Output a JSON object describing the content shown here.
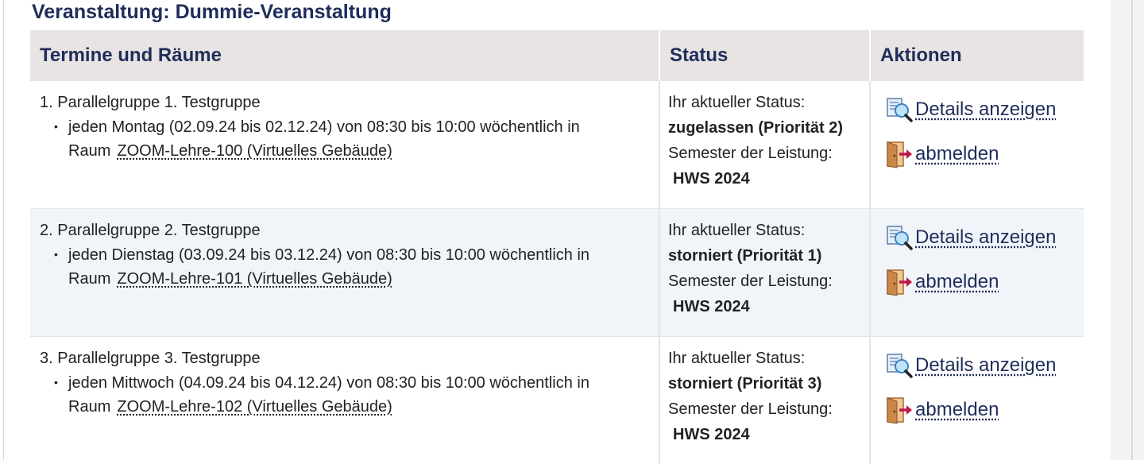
{
  "page": {
    "heading": "Veranstaltung: Dummie-Veranstaltung"
  },
  "table": {
    "headers": {
      "col1": "Termine und Räume",
      "col2": "Status",
      "col3": "Aktionen"
    },
    "rows": [
      {
        "group": "1. Parallelgruppe 1. Testgruppe",
        "schedule": "jeden Montag (02.09.24 bis 02.12.24) von 08:30 bis 10:00 wöchentlich in",
        "room_prefix": "Raum",
        "room": "ZOOM-Lehre-100 (Virtuelles Gebäude)",
        "status_label": "Ihr aktueller Status:",
        "status_value": "zugelassen (Priorität 2)",
        "semester_label": "Semester der Leistung:",
        "semester_value": "HWS 2024",
        "details_label": "Details anzeigen",
        "unregister_label": "abmelden"
      },
      {
        "group": "2. Parallelgruppe 2. Testgruppe",
        "schedule": "jeden Dienstag (03.09.24 bis 03.12.24) von 08:30 bis 10:00 wöchentlich in",
        "room_prefix": "Raum",
        "room": "ZOOM-Lehre-101 (Virtuelles Gebäude)",
        "status_label": "Ihr aktueller Status:",
        "status_value": "storniert (Priorität 1)",
        "semester_label": "Semester der Leistung:",
        "semester_value": "HWS 2024",
        "details_label": "Details anzeigen",
        "unregister_label": "abmelden"
      },
      {
        "group": "3. Parallelgruppe 3. Testgruppe",
        "schedule": "jeden Mittwoch (04.09.24 bis 04.12.24) von 08:30 bis 10:00 wöchentlich in",
        "room_prefix": "Raum",
        "room": "ZOOM-Lehre-102 (Virtuelles Gebäude)",
        "status_label": "Ihr aktueller Status:",
        "status_value": "storniert (Priorität 3)",
        "semester_label": "Semester der Leistung:",
        "semester_value": "HWS 2024",
        "details_label": "Details anzeigen",
        "unregister_label": "abmelden"
      }
    ]
  },
  "icons": {
    "details": "details-magnifier-icon",
    "unregister": "door-exit-icon"
  },
  "colors": {
    "heading": "#1f2d5a",
    "header_bg": "#e8e4e3",
    "row_alt_bg": "#f1f5f9",
    "door": "#c9874a",
    "arrow": "#c0174b"
  }
}
